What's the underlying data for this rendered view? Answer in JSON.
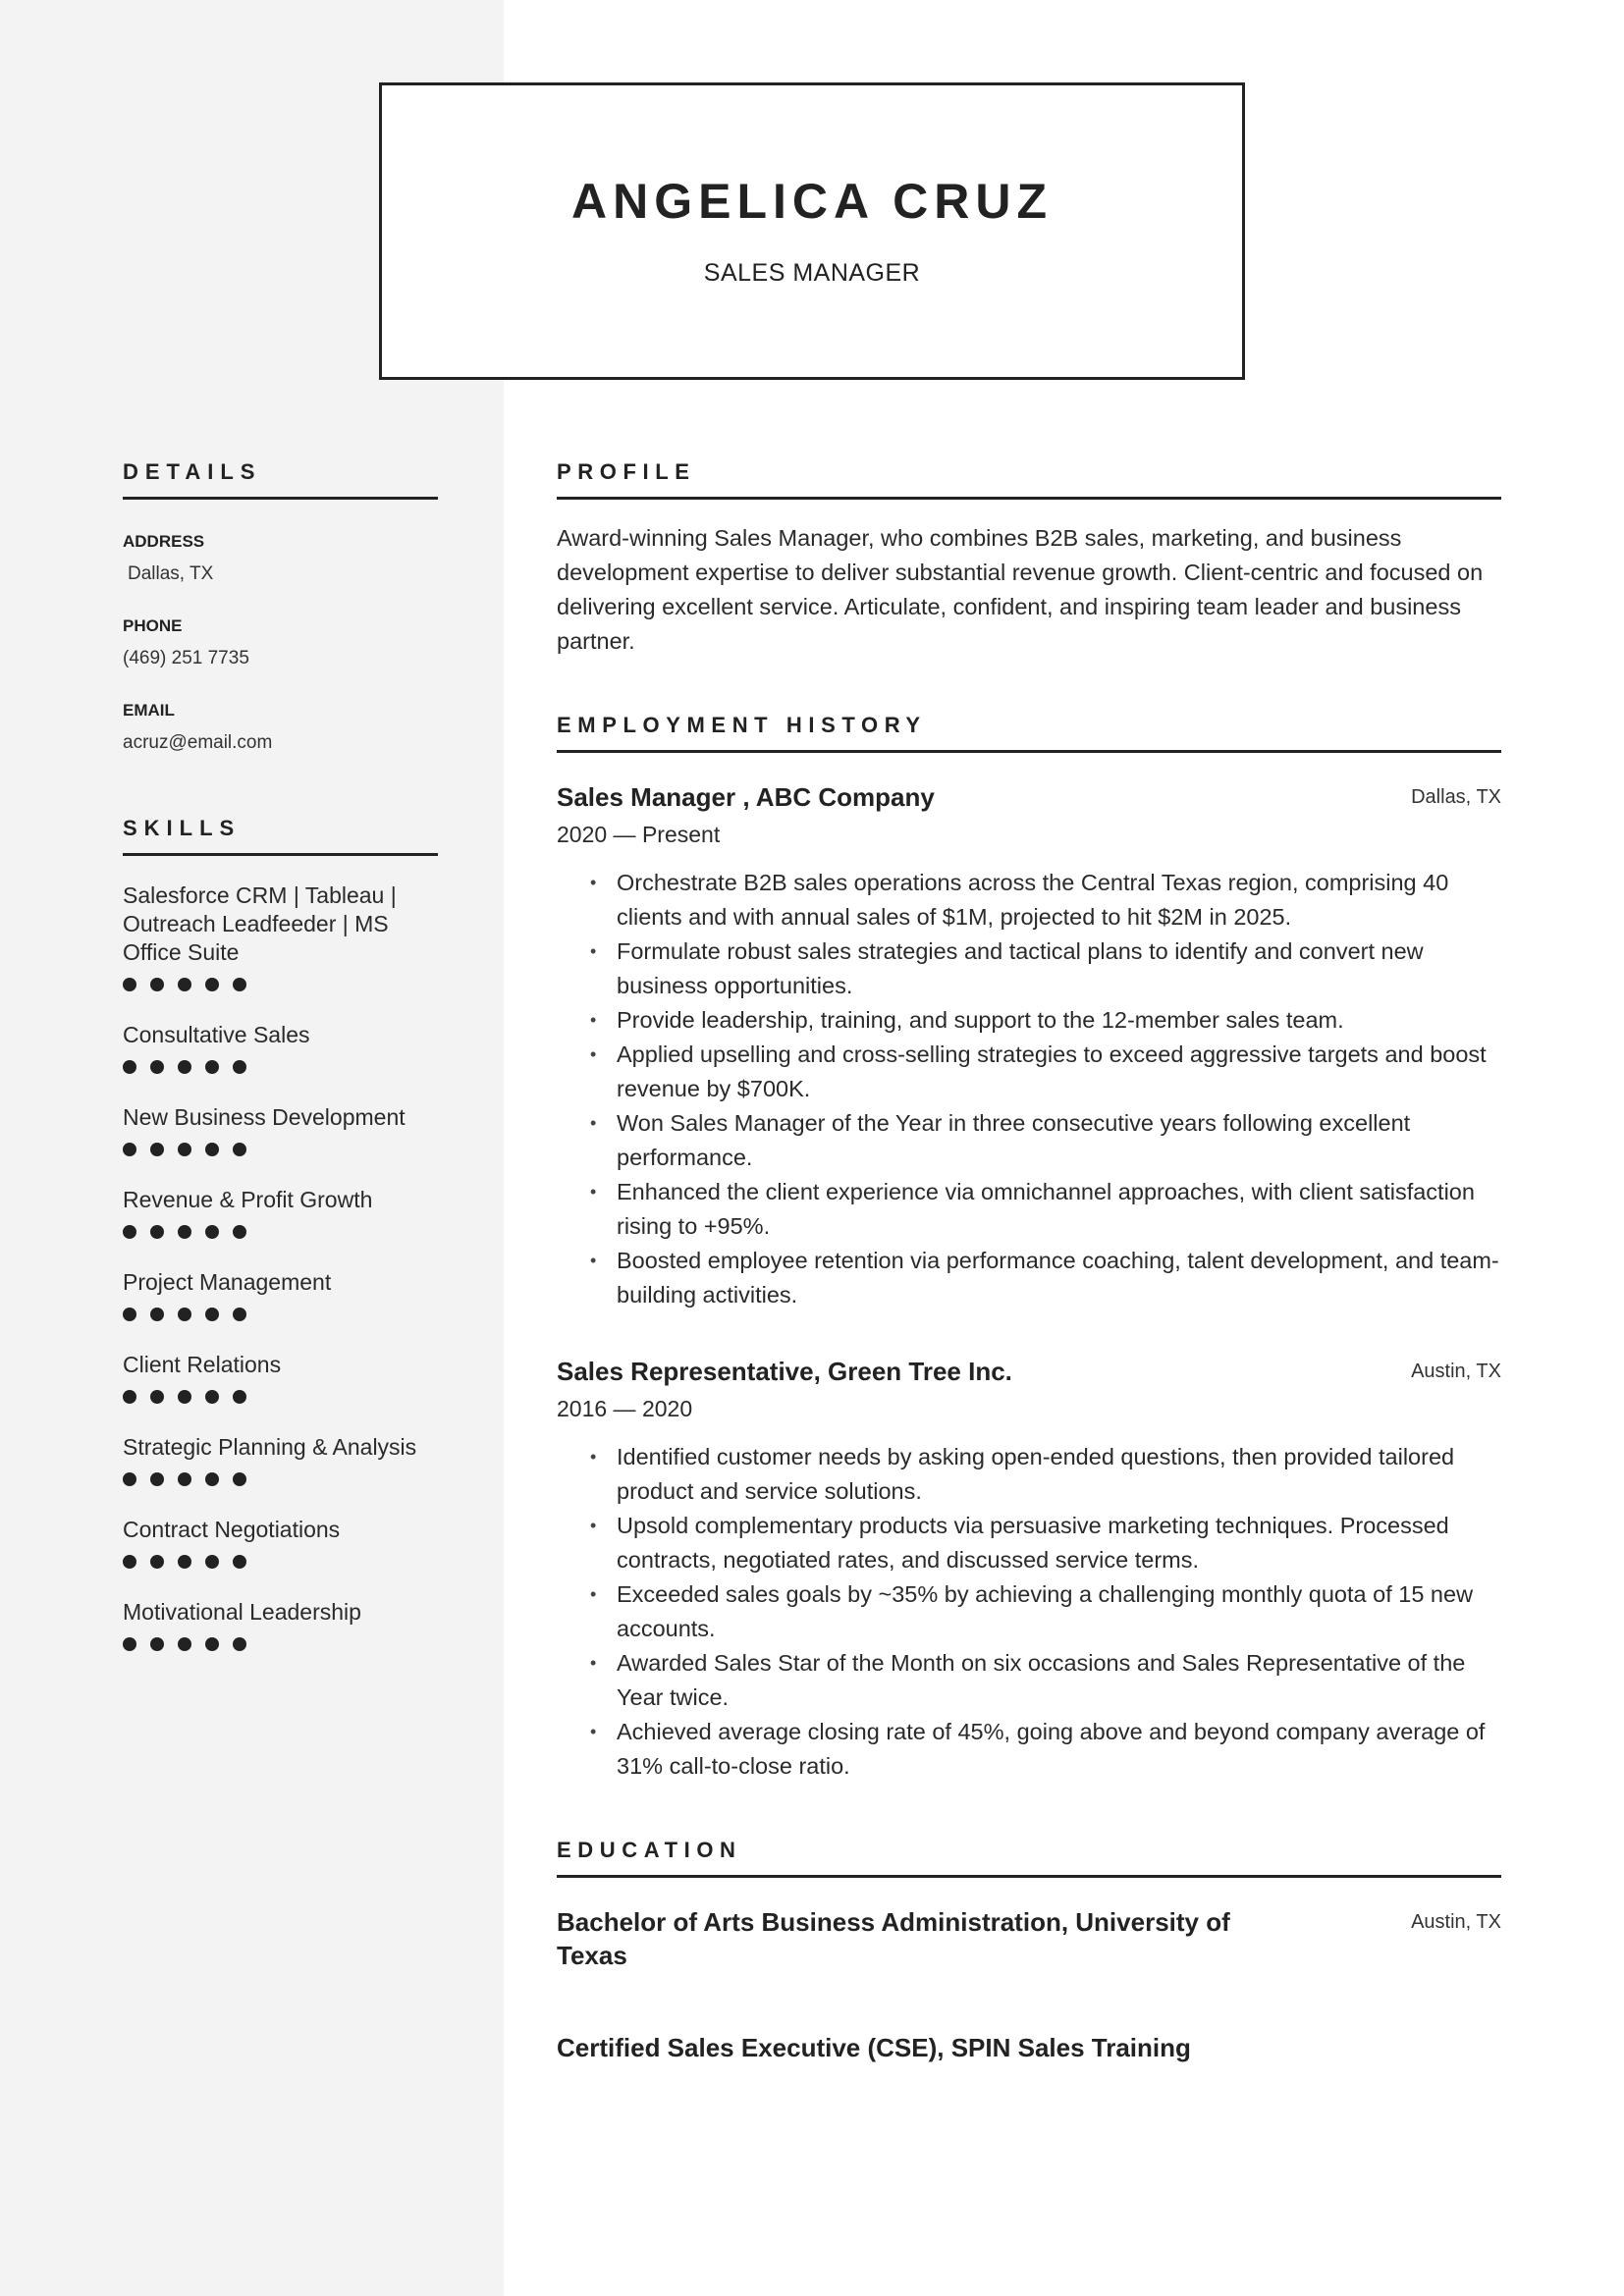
{
  "header": {
    "name": "ANGELICA CRUZ",
    "title": "SALES MANAGER"
  },
  "sidebar": {
    "details": {
      "heading": "DETAILS",
      "items": [
        {
          "label": "ADDRESS",
          "value": "Dallas, TX"
        },
        {
          "label": "PHONE",
          "value": "(469) 251 7735"
        },
        {
          "label": "EMAIL",
          "value": "acruz@email.com"
        }
      ]
    },
    "skills": {
      "heading": "SKILLS",
      "items": [
        {
          "name": "Salesforce CRM | Tableau | Outreach  Leadfeeder | MS Office Suite",
          "level": 5,
          "max": 5
        },
        {
          "name": "Consultative Sales",
          "level": 5,
          "max": 5
        },
        {
          "name": "New Business Development",
          "level": 5,
          "max": 5
        },
        {
          "name": "Revenue & Profit Growth",
          "level": 5,
          "max": 5
        },
        {
          "name": "Project Management",
          "level": 5,
          "max": 5
        },
        {
          "name": "Client Relations",
          "level": 5,
          "max": 5
        },
        {
          "name": "Strategic Planning & Analysis",
          "level": 5,
          "max": 5
        },
        {
          "name": "Contract Negotiations",
          "level": 5,
          "max": 5
        },
        {
          "name": "Motivational Leadership",
          "level": 5,
          "max": 5
        }
      ]
    }
  },
  "main": {
    "profile": {
      "heading": "PROFILE",
      "text": "Award-winning Sales Manager, who combines B2B sales, marketing, and business development expertise to deliver substantial revenue growth. Client-centric and focused on delivering excellent service. Articulate, confident, and inspiring team leader and business partner."
    },
    "employment": {
      "heading": "EMPLOYMENT HISTORY",
      "jobs": [
        {
          "title": "Sales Manager , ABC Company",
          "location": "Dallas, TX",
          "dates": "2020 — Present",
          "bullets": [
            "Orchestrate B2B sales operations across the Central Texas region, comprising 40 clients and with annual sales of $1M, projected to hit $2M in 2025.",
            "Formulate robust sales strategies and tactical plans to identify and convert new business opportunities.",
            "Provide leadership, training, and support to the 12-member sales team.",
            "Applied upselling and cross-selling strategies to exceed aggressive targets and boost revenue by $700K.",
            "Won Sales Manager of the Year in three consecutive years following excellent performance.",
            "Enhanced the client experience via omnichannel approaches, with client satisfaction rising to +95%.",
            "Boosted employee retention via performance coaching, talent development, and team-building activities."
          ]
        },
        {
          "title": "Sales Representative, Green Tree Inc.",
          "location": "Austin, TX",
          "dates": "2016 — 2020",
          "bullets": [
            "Identified customer needs by asking open-ended questions, then provided tailored product and service solutions.",
            "Upsold complementary products via persuasive marketing techniques. Processed contracts, negotiated rates, and discussed service terms.",
            "Exceeded sales goals by ~35% by achieving a challenging monthly quota of 15 new accounts.",
            "Awarded Sales Star of the Month on six occasions and Sales Representative of the Year twice.",
            "Achieved average closing rate of 45%, going above and beyond company average of 31% call-to-close ratio."
          ]
        }
      ]
    },
    "education": {
      "heading": "EDUCATION",
      "items": [
        {
          "title": "Bachelor of Arts Business Administration, University of Texas",
          "location": "Austin, TX"
        },
        {
          "title": "Certified Sales Executive (CSE), SPIN Sales Training",
          "location": ""
        }
      ]
    }
  },
  "bullet_glyph": "•"
}
